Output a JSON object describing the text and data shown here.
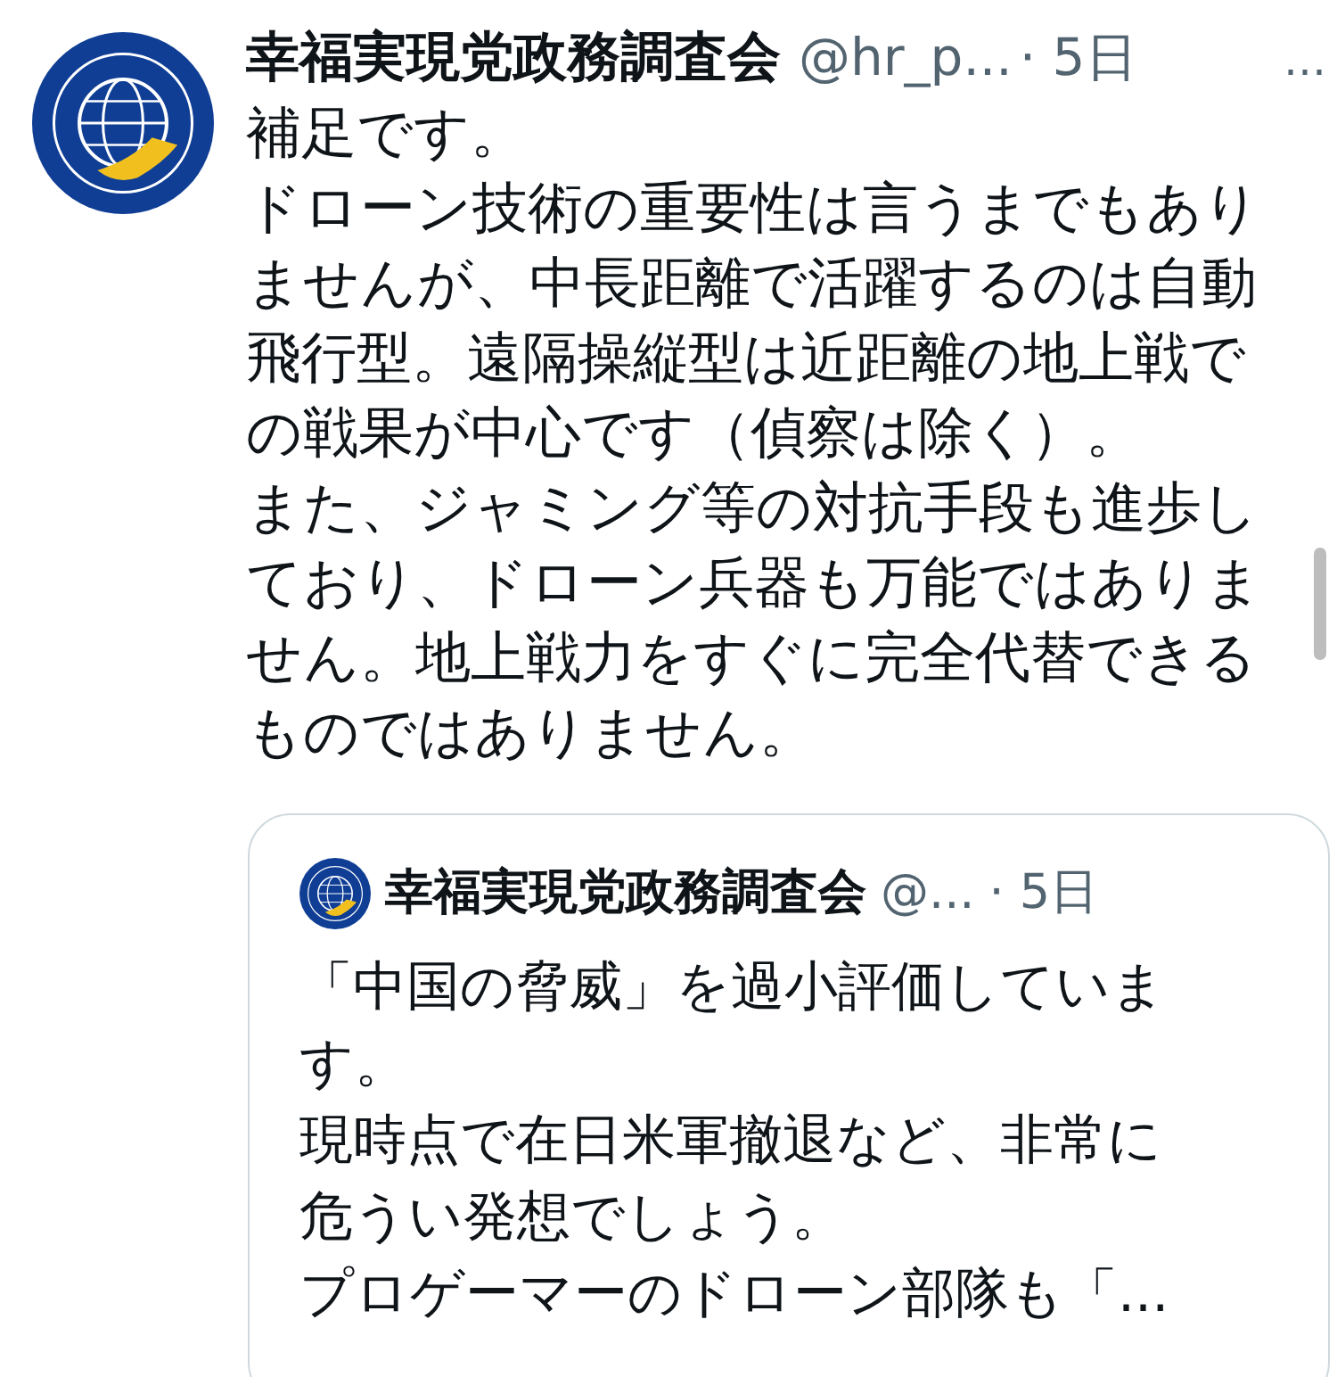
{
  "post": {
    "name": "幸福実現党政務調査会",
    "handle": "@hr_p...",
    "time": "· 5日",
    "more": "…",
    "lines": [
      "補足です。",
      "ドローン技術の重要性は言うまでもあり",
      "ませんが、中長距離で活躍するのは自動",
      "飛行型。遠隔操縦型は近距離の地上戦で",
      "の戦果が中心です（偵察は除く）。",
      "また、ジャミング等の対抗手段も進歩し",
      "ており、ドローン兵器も万能ではありま",
      "せん。地上戦力をすぐに完全代替できる",
      "ものではありません。"
    ]
  },
  "quote": {
    "name": "幸福実現党政務調査会",
    "handle": "@...",
    "time": "· 5日",
    "lines": [
      "「中国の脅威」を過小評価していま",
      "す。",
      "現時点で在日米軍撤退など、非常に",
      "危うい発想でしょう。",
      "プロゲーマーのドローン部隊も「..."
    ]
  }
}
